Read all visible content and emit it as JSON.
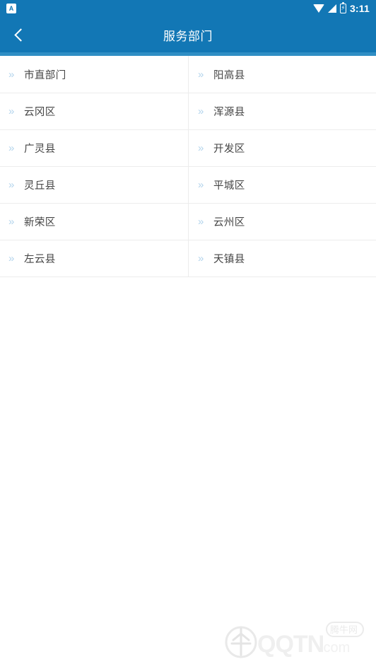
{
  "status_bar": {
    "notification_icon": "app-notification-icon",
    "notification_glyph": "A",
    "icons": [
      "wifi-icon",
      "cellular-signal-icon",
      "battery-charging-icon"
    ],
    "time": "3:11"
  },
  "app_bar": {
    "back_icon": "back-chevron-icon",
    "title": "服务部门",
    "background_color": "#1277b5",
    "underline_color": "#2f8ec4"
  },
  "list": {
    "chevron_icon": "double-chevron-right-icon",
    "chevron_glyph": "»",
    "chevron_color": "#b3d4ec",
    "text_color": "#444444",
    "divider_color": "#ececec",
    "items": [
      {
        "label": "市直部门",
        "column": "left"
      },
      {
        "label": "阳高县",
        "column": "right"
      },
      {
        "label": "云冈区",
        "column": "left"
      },
      {
        "label": "浑源县",
        "column": "right"
      },
      {
        "label": "广灵县",
        "column": "left"
      },
      {
        "label": "开发区",
        "column": "right"
      },
      {
        "label": "灵丘县",
        "column": "left"
      },
      {
        "label": "平城区",
        "column": "right"
      },
      {
        "label": "新荣区",
        "column": "left"
      },
      {
        "label": "云州区",
        "column": "right"
      },
      {
        "label": "左云县",
        "column": "left"
      },
      {
        "label": "天镇县",
        "column": "right"
      }
    ]
  },
  "watermark": {
    "logo_icon": "qqtn-globe-logo-icon",
    "site_name": "QQTN",
    "site_suffix": ".com",
    "badge_text": "腾牛网"
  }
}
